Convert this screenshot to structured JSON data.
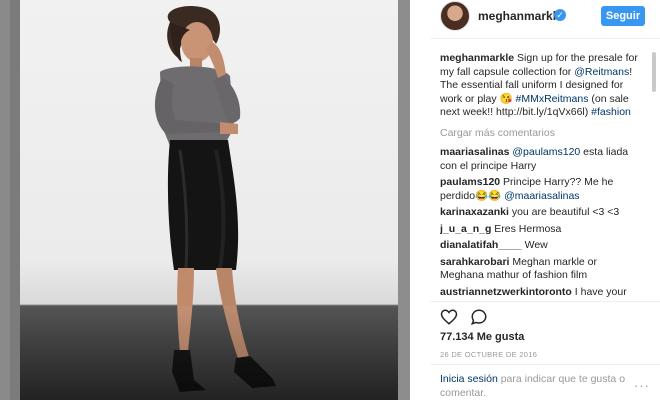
{
  "post": {
    "username": "meghanmarkle",
    "follow_label": "Seguir",
    "caption_pre": "Sign up for the presale for my fall capsule collection for ",
    "caption_mention": "@Reitmans",
    "caption_mid": "! The essential fall uniform I designed for work or play 😘 ",
    "caption_hashtag1": "#MMxReitmans",
    "caption_post": " (on sale next week!! http://bit.ly/1qVx66l) ",
    "caption_hashtag2": "#fashion",
    "load_more": "Cargar más comentarios",
    "likes": "77.134 Me gusta",
    "date": "26 DE OCTUBRE DE 2016",
    "login_link": "Inicia sesión",
    "login_text": " para indicar que te gusta o comentar.",
    "more": "···"
  },
  "comments": [
    {
      "user": "maariasalinas",
      "mention": "@paulams120",
      "text": " esta liada con el principe Harry"
    },
    {
      "user": "paulams120",
      "mention": "",
      "text": "Principe Harry?? Me he perdido😂😂 ",
      "mention2": "@maariasalinas"
    },
    {
      "user": "karinaxazanki",
      "mention": "",
      "text": "you are beautiful <3 <3"
    },
    {
      "user": "j_u_a_n_g",
      "mention": "",
      "text": "Eres Hermosa"
    },
    {
      "user": "dianalatifah____",
      "mention": "",
      "text": "Wew"
    },
    {
      "user": "sarahkarobari",
      "mention": "",
      "text": "Meghan markle or Meghana mathur of fashion film"
    },
    {
      "user": "austriannetzwerkintoronto",
      "mention": "",
      "text": "I have your pants, they feel amazing!🙌🏻😂"
    }
  ],
  "icons": {
    "heart": "heart-icon",
    "comment": "comment-icon",
    "verified": "verified-badge-icon"
  },
  "colors": {
    "accent": "#3897f0",
    "link": "#003569",
    "muted": "#999999"
  }
}
